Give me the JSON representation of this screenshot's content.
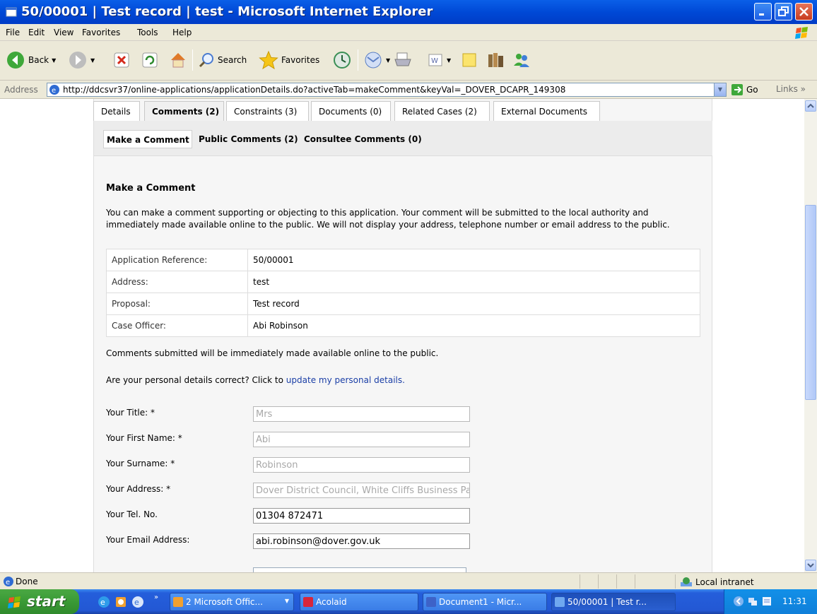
{
  "window": {
    "title": "50/00001 | Test record | test - Microsoft Internet Explorer"
  },
  "menu": [
    "File",
    "Edit",
    "View",
    "Favorites",
    "Tools",
    "Help"
  ],
  "toolbar": {
    "back_label": "Back",
    "search_label": "Search",
    "favorites_label": "Favorites"
  },
  "address": {
    "label": "Address",
    "url": "http://ddcsvr37/online-applications/applicationDetails.do?activeTab=makeComment&keyVal=_DOVER_DCAPR_149308",
    "go_label": "Go",
    "links_label": "Links"
  },
  "tabs": [
    {
      "label": "Details",
      "active": false
    },
    {
      "label": "Comments (2)",
      "active": true
    },
    {
      "label": "Constraints (3)",
      "active": false
    },
    {
      "label": "Documents (0)",
      "active": false
    },
    {
      "label": "Related Cases (2)",
      "active": false
    },
    {
      "label": "External Documents",
      "active": false
    }
  ],
  "subtabs": [
    {
      "label": "Make a Comment",
      "active": true
    },
    {
      "label": "Public Comments (2)",
      "active": false
    },
    {
      "label": "Consultee Comments (0)",
      "active": false
    }
  ],
  "main": {
    "section_title": "Make a Comment",
    "intro_line1": "You can make a comment supporting or objecting to this application. Your comment will be submitted to the local authority and",
    "intro_line2": "immediately made available online to the public. We will not display your address, telephone number or email address to the public.",
    "summary": [
      {
        "key": "Application Reference:",
        "value": "50/00001"
      },
      {
        "key": "Address:",
        "value": "test"
      },
      {
        "key": "Proposal:",
        "value": "Test record"
      },
      {
        "key": "Case Officer:",
        "value": "Abi Robinson"
      }
    ],
    "note": "Comments submitted will be immediately made available online to the public.",
    "personal_prefix": "Are your personal details correct? Click to",
    "personal_link": "update my personal details."
  },
  "form": {
    "fields": [
      {
        "label": "Your Title: *",
        "value": "Mrs",
        "disabled": true
      },
      {
        "label": "Your First Name: *",
        "value": "Abi",
        "disabled": true
      },
      {
        "label": "Your Surname: *",
        "value": "Robinson",
        "disabled": true
      },
      {
        "label": "Your Address: *",
        "value": "Dover District Council, White Cliffs Business Pa",
        "disabled": true
      },
      {
        "label": "Your Tel. No.",
        "value": "01304 872471",
        "disabled": false
      },
      {
        "label": "Your Email Address:",
        "value": "abi.robinson@dover.gov.uk",
        "disabled": false
      }
    ]
  },
  "status": {
    "text": "Done",
    "zone": "Local intranet"
  },
  "taskbar": {
    "start_label": "start",
    "tasks": [
      {
        "label": "2 Microsoft Offic...",
        "active": false
      },
      {
        "label": "Acolaid",
        "active": false
      },
      {
        "label": "Document1 - Micr...",
        "active": false
      },
      {
        "label": "50/00001 | Test r...",
        "active": true
      }
    ],
    "clock": "11:31"
  },
  "colors": {
    "title_bar": "#0049d6",
    "link": "#1a3ea6",
    "start_green": "#3a9a36",
    "taskbar_blue": "#2358d4"
  }
}
